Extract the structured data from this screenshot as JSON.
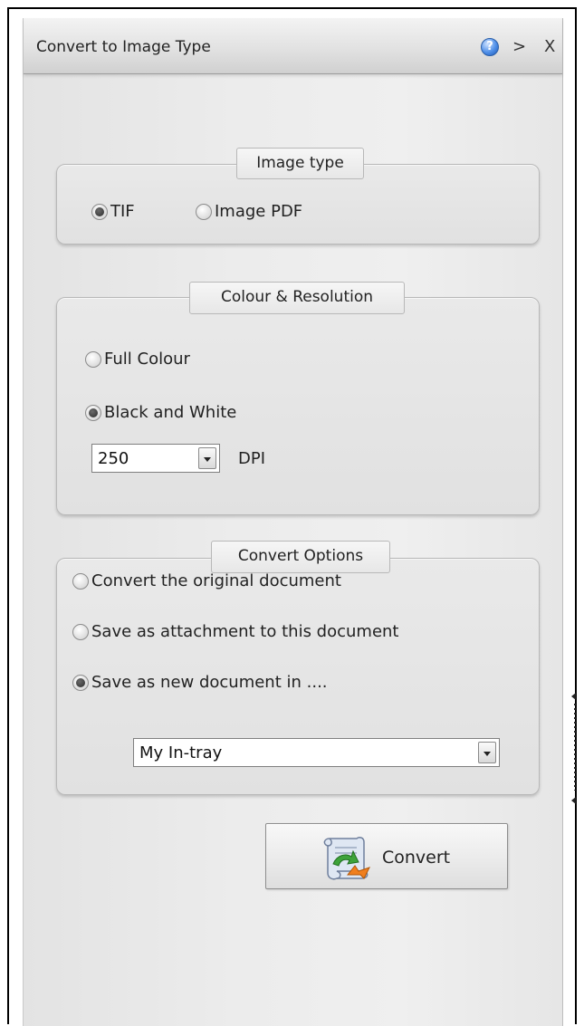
{
  "window": {
    "title": "Convert to Image Type",
    "help_icon": "question-circle-icon",
    "help_glyph": "?",
    "collapse_label": ">",
    "close_label": "X"
  },
  "image_type": {
    "legend": "Image type",
    "options": [
      {
        "label": "TIF",
        "checked": true
      },
      {
        "label": "Image PDF",
        "checked": false
      }
    ]
  },
  "colour_resolution": {
    "legend": "Colour & Resolution",
    "options": [
      {
        "label": "Full Colour",
        "checked": false
      },
      {
        "label": "Black and White",
        "checked": true
      }
    ],
    "dpi_value": "250",
    "dpi_label": "DPI"
  },
  "convert_options": {
    "legend": "Convert Options",
    "options": [
      {
        "label": "Convert the original document",
        "checked": false
      },
      {
        "label": "Save as attachment to this document",
        "checked": false
      },
      {
        "label": "Save as new document in ....",
        "checked": true
      }
    ],
    "destination_value": "My In-tray"
  },
  "convert_button": {
    "label": "Convert",
    "icon": "scroll-convert-icon"
  },
  "colors": {
    "radio_checked": "#2b2b2b",
    "help_icon_blue": "#4f8fe8"
  }
}
